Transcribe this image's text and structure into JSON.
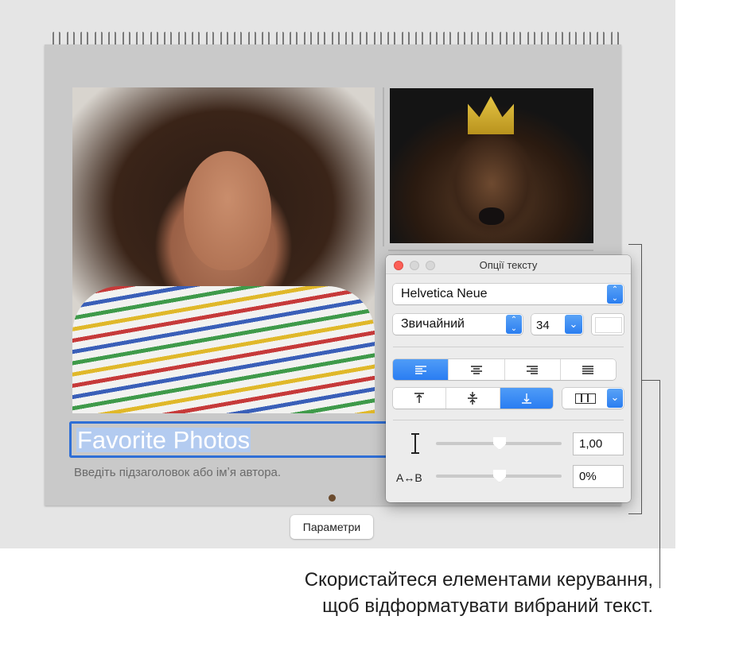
{
  "calendar": {
    "title_text": "Favorite Photos",
    "subtitle_placeholder": "Введіть підзаголовок або імʼя автора."
  },
  "params_button_label": "Параметри",
  "text_options_panel": {
    "title": "Опції тексту",
    "font_family": "Helvetica Neue",
    "font_style": "Звичайний",
    "font_size": "34",
    "text_color": "#ffffff",
    "alignment_options": [
      "align-left",
      "align-center",
      "align-right",
      "justify"
    ],
    "alignment_selected": "align-left",
    "vertical_alignment_options": [
      "top",
      "middle",
      "bottom"
    ],
    "vertical_alignment_selected": "bottom",
    "character_spacing_label": "A↔B",
    "line_spacing_value": "1,00",
    "character_spacing_value": "0%"
  },
  "caption": {
    "line1": "Скористайтеся елементами керування,",
    "line2": "щоб відформатувати вибраний текст."
  },
  "colors": {
    "accent": "#2f6fd6",
    "close_button": "#fc5f57"
  }
}
